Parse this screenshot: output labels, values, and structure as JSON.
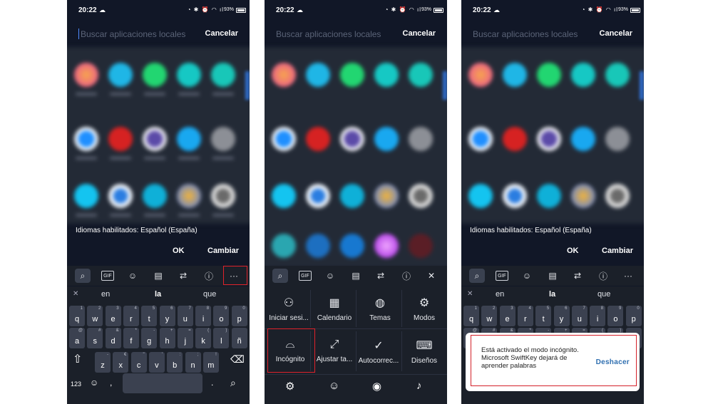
{
  "status": {
    "time": "20:22",
    "battery": "93%"
  },
  "search": {
    "placeholder": "Buscar aplicaciones locales",
    "cancel": "Cancelar"
  },
  "languages_text": "Idiomas habilitados: Español (España)",
  "buttons": {
    "ok": "OK",
    "change": "Cambiar"
  },
  "toolbar": {
    "gif": "GIF",
    "more": "···",
    "close": "✕"
  },
  "suggestions": [
    "en",
    "la",
    "que"
  ],
  "keyboard": {
    "row1": [
      {
        "k": "q",
        "s": "1"
      },
      {
        "k": "w",
        "s": "2"
      },
      {
        "k": "e",
        "s": "3"
      },
      {
        "k": "r",
        "s": "4"
      },
      {
        "k": "t",
        "s": "5"
      },
      {
        "k": "y",
        "s": "6"
      },
      {
        "k": "u",
        "s": "7"
      },
      {
        "k": "i",
        "s": "8"
      },
      {
        "k": "o",
        "s": "9"
      },
      {
        "k": "p",
        "s": "0"
      }
    ],
    "row2": [
      {
        "k": "a",
        "s": "@"
      },
      {
        "k": "s",
        "s": "#"
      },
      {
        "k": "d",
        "s": "&"
      },
      {
        "k": "f",
        "s": "*"
      },
      {
        "k": "g",
        "s": "-"
      },
      {
        "k": "h",
        "s": "+"
      },
      {
        "k": "j",
        "s": "="
      },
      {
        "k": "k",
        "s": "("
      },
      {
        "k": "l",
        "s": ")"
      },
      {
        "k": "ñ",
        "s": ""
      }
    ],
    "row3": [
      {
        "k": "z",
        "s": "-"
      },
      {
        "k": "x",
        "s": "€"
      },
      {
        "k": "c",
        "s": "\""
      },
      {
        "k": "v",
        "s": "'"
      },
      {
        "k": "b",
        "s": ":"
      },
      {
        "k": "n",
        "s": ";"
      },
      {
        "k": "m",
        "s": "!"
      }
    ],
    "numbers_key": "123",
    "comma_key": ",",
    "period_key": "."
  },
  "menu": {
    "items": [
      {
        "label": "Iniciar sesi...",
        "icon": "person-icon"
      },
      {
        "label": "Calendario",
        "icon": "calendar-icon"
      },
      {
        "label": "Temas",
        "icon": "palette-icon"
      },
      {
        "label": "Modos",
        "icon": "modes-icon"
      },
      {
        "label": "Incógnito",
        "icon": "incognito-icon"
      },
      {
        "label": "Ajustar ta...",
        "icon": "resize-icon"
      },
      {
        "label": "Autocorrec...",
        "icon": "autocorrect-icon"
      },
      {
        "label": "Diseños",
        "icon": "keyboard-icon"
      }
    ]
  },
  "toast": {
    "message": "Está activado el modo incógnito. Microsoft SwiftKey dejará de aprender palabras",
    "action": "Deshacer"
  },
  "colors": {
    "bg": "#111727",
    "keyboard": "#1b2029",
    "key": "#3b4150",
    "highlight": "#e0222b",
    "link": "#2f6fb0"
  }
}
